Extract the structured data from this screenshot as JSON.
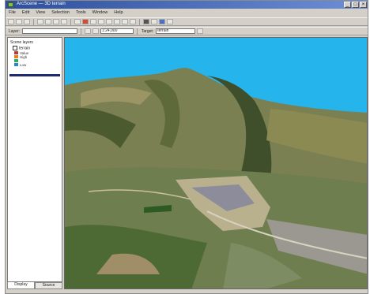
{
  "window": {
    "title": "ArcScene — 3D terrain"
  },
  "menu": [
    "File",
    "Edit",
    "View",
    "Selection",
    "Tools",
    "Window",
    "Help"
  ],
  "toolbar": {
    "layer_combo": "Layer:",
    "zoom_combo": "1:24,000",
    "target_label": "Target:",
    "target_value": "terrain"
  },
  "toc": {
    "root": "Scene layers",
    "layer_name": "terrain",
    "legend": [
      {
        "label": "Value",
        "color": "#c0392b"
      },
      {
        "label": "High",
        "color": "#e67e22"
      },
      {
        "label": "",
        "color": "#27ae60"
      },
      {
        "label": "Low",
        "color": "#2e86c1"
      }
    ]
  },
  "tabs": [
    "Display",
    "Source"
  ],
  "scene": {
    "sky_color": "#26b4ec",
    "terrain_colors": [
      "#5e6a3a",
      "#8a8a52",
      "#9f9463",
      "#3e5d2b",
      "#b9b08e",
      "#7b8f5a"
    ]
  }
}
